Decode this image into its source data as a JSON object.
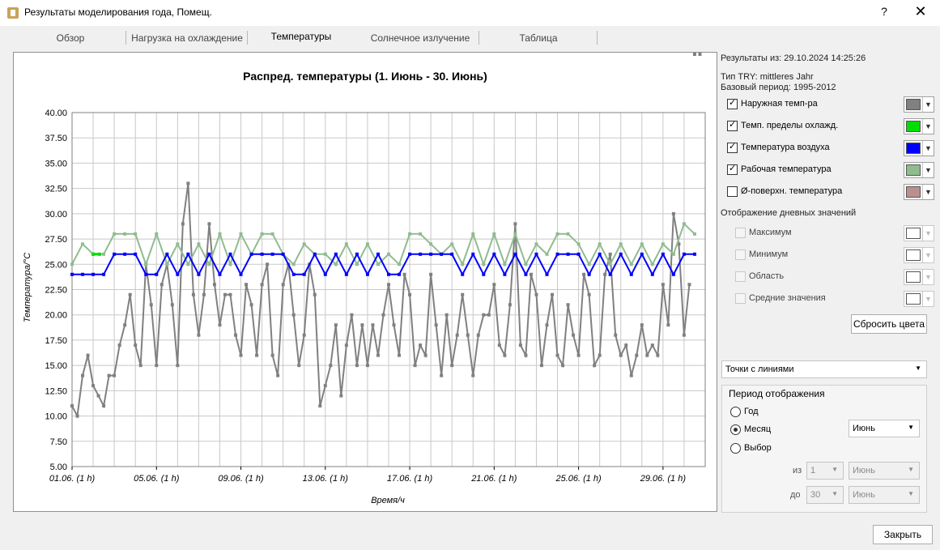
{
  "window": {
    "title": "Результаты моделирования года, Помещ.",
    "help": "?",
    "close": "✕"
  },
  "tabs": [
    "Обзор",
    "Нагрузка на охлаждение",
    "Температуры",
    "Солнечное излучение",
    "Таблица"
  ],
  "active_tab": "Температуры",
  "info": {
    "results_from": "Результаты из: 29.10.2024 14:25:26",
    "try_type": "Тип TRY: mittleres Jahr",
    "base_period": "Базовый период: 1995-2012"
  },
  "series_toggles": [
    {
      "label": "Наружная темп-ра",
      "checked": true,
      "color": "#808080"
    },
    {
      "label": "Темп. пределы охлажд.",
      "checked": true,
      "color": "#00dd00"
    },
    {
      "label": "Температура воздуха",
      "checked": true,
      "color": "#0000ff"
    },
    {
      "label": "Рабочая температура",
      "checked": true,
      "color": "#8fbc8f"
    },
    {
      "label": "Ø-поверхн. температура",
      "checked": false,
      "color": "#bc8f8f"
    }
  ],
  "daily_heading": "Отображение дневных значений",
  "daily_toggles": [
    {
      "label": "Максимум",
      "checked": false
    },
    {
      "label": "Минимум",
      "checked": false
    },
    {
      "label": "Область",
      "checked": false
    },
    {
      "label": "Средние значения",
      "checked": false
    }
  ],
  "reset_colors": "Сбросить цвета",
  "plot_style": "Точки с линиями",
  "period": {
    "title": "Период отображения",
    "options": [
      "Год",
      "Месяц",
      "Выбор"
    ],
    "selected": "Месяц",
    "month": "Июнь",
    "from_label": "из",
    "to_label": "до",
    "from_day": "1",
    "from_month": "Июнь",
    "to_day": "30",
    "to_month": "Июнь"
  },
  "close_button": "Закрыть",
  "chart_data": {
    "type": "line",
    "title": "Распред. температуры (1. Июнь - 30. Июнь)",
    "xlabel": "Время/ч",
    "ylabel": "Температура/°C",
    "ylim": [
      5,
      40
    ],
    "yticks": [
      "5.00",
      "7.50",
      "10.00",
      "12.50",
      "15.00",
      "17.50",
      "20.00",
      "22.50",
      "25.00",
      "27.50",
      "30.00",
      "32.50",
      "35.00",
      "37.50",
      "40.00"
    ],
    "xlim_days": [
      1,
      31
    ],
    "xtick_labels": [
      "01.06. (1 h)",
      "05.06. (1 h)",
      "09.06. (1 h)",
      "13.06. (1 h)",
      "17.06. (1 h)",
      "21.06. (1 h)",
      "25.06. (1 h)",
      "29.06. (1 h)"
    ],
    "xtick_days": [
      1,
      5,
      9,
      13,
      17,
      21,
      25,
      29
    ],
    "grid": true,
    "series": [
      {
        "name": "Наружная темп-ра",
        "color": "#808080",
        "days": [
          1,
          1.25,
          1.5,
          1.75,
          2,
          2.25,
          2.5,
          2.75,
          3,
          3.25,
          3.5,
          3.75,
          4,
          4.25,
          4.5,
          4.75,
          5,
          5.25,
          5.5,
          5.75,
          6,
          6.25,
          6.5,
          6.75,
          7,
          7.25,
          7.5,
          7.75,
          8,
          8.25,
          8.5,
          8.75,
          9,
          9.25,
          9.5,
          9.75,
          10,
          10.25,
          10.5,
          10.75,
          11,
          11.25,
          11.5,
          11.75,
          12,
          12.25,
          12.5,
          12.75,
          13,
          13.25,
          13.5,
          13.75,
          14,
          14.25,
          14.5,
          14.75,
          15,
          15.25,
          15.5,
          15.75,
          16,
          16.25,
          16.5,
          16.75,
          17,
          17.25,
          17.5,
          17.75,
          18,
          18.25,
          18.5,
          18.75,
          19,
          19.25,
          19.5,
          19.75,
          20,
          20.25,
          20.5,
          20.75,
          21,
          21.25,
          21.5,
          21.75,
          22,
          22.25,
          22.5,
          22.75,
          23,
          23.25,
          23.5,
          23.75,
          24,
          24.25,
          24.5,
          24.75,
          25,
          25.25,
          25.5,
          25.75,
          26,
          26.25,
          26.5,
          26.75,
          27,
          27.25,
          27.5,
          27.75,
          28,
          28.25,
          28.5,
          28.75,
          29,
          29.25,
          29.5,
          29.75,
          30,
          30.25,
          30.5,
          30.75
        ],
        "values": [
          11,
          10,
          14,
          16,
          13,
          12,
          11,
          14,
          14,
          17,
          19,
          22,
          17,
          15,
          25,
          21,
          15,
          23,
          25,
          21,
          15,
          29,
          33,
          22,
          18,
          22,
          29,
          23,
          19,
          22,
          22,
          18,
          16,
          23,
          21,
          16,
          23,
          25,
          16,
          14,
          23,
          25,
          20,
          15,
          18,
          25,
          22,
          11,
          13,
          15,
          19,
          12,
          17,
          20,
          15,
          19,
          15,
          19,
          16,
          20,
          23,
          19,
          16,
          24,
          22,
          15,
          17,
          16,
          24,
          19,
          14,
          20,
          15,
          18,
          22,
          18,
          14,
          18,
          20,
          20,
          23,
          17,
          16,
          21,
          29,
          17,
          16,
          24,
          22,
          15,
          19,
          22,
          16,
          15,
          21,
          18,
          16,
          24,
          22,
          15,
          16,
          24,
          26,
          18,
          16,
          17,
          14,
          16,
          19,
          16,
          17,
          16,
          23,
          19,
          30,
          27,
          18,
          23
        ]
      },
      {
        "name": "Темп. пределы охлажд.",
        "color": "#00dd00",
        "days": [
          2,
          2.3
        ],
        "values": [
          26,
          26
        ]
      },
      {
        "name": "Температура воздуха",
        "color": "#0000ff",
        "days": [
          1,
          1.5,
          2,
          2.5,
          3,
          3.5,
          4,
          4.5,
          5,
          5.5,
          6,
          6.5,
          7,
          7.5,
          8,
          8.5,
          9,
          9.5,
          10,
          10.5,
          11,
          11.5,
          12,
          12.5,
          13,
          13.5,
          14,
          14.5,
          15,
          15.5,
          16,
          16.5,
          17,
          17.5,
          18,
          18.5,
          19,
          19.5,
          20,
          20.5,
          21,
          21.5,
          22,
          22.5,
          23,
          23.5,
          24,
          24.5,
          25,
          25.5,
          26,
          26.5,
          27,
          27.5,
          28,
          28.5,
          29,
          29.5,
          30,
          30.5
        ],
        "values": [
          24,
          24,
          24,
          24,
          26,
          26,
          26,
          24,
          24,
          26,
          24,
          26,
          24,
          26,
          24,
          26,
          24,
          26,
          26,
          26,
          26,
          24,
          24,
          26,
          24,
          26,
          24,
          26,
          24,
          26,
          24,
          24,
          26,
          26,
          26,
          26,
          26,
          24,
          26,
          24,
          26,
          24,
          26,
          24,
          26,
          24,
          26,
          26,
          26,
          24,
          26,
          24,
          26,
          24,
          26,
          24,
          26,
          24,
          26,
          26
        ]
      },
      {
        "name": "Рабочая температура",
        "color": "#8fbc8f",
        "days": [
          1,
          1.5,
          2,
          2.5,
          3,
          3.5,
          4,
          4.5,
          5,
          5.5,
          6,
          6.5,
          7,
          7.5,
          8,
          8.5,
          9,
          9.5,
          10,
          10.5,
          11,
          11.5,
          12,
          12.5,
          13,
          13.5,
          14,
          14.5,
          15,
          15.5,
          16,
          16.5,
          17,
          17.5,
          18,
          18.5,
          19,
          19.5,
          20,
          20.5,
          21,
          21.5,
          22,
          22.5,
          23,
          23.5,
          24,
          24.5,
          25,
          25.5,
          26,
          26.5,
          27,
          27.5,
          28,
          28.5,
          29,
          29.5,
          30,
          30.5
        ],
        "values": [
          25,
          27,
          26,
          26,
          28,
          28,
          28,
          25,
          28,
          25,
          27,
          25,
          27,
          25,
          28,
          25,
          28,
          26,
          28,
          28,
          26,
          25,
          27,
          26,
          26,
          25,
          27,
          25,
          27,
          25,
          26,
          25,
          28,
          28,
          27,
          26,
          27,
          25,
          28,
          25,
          28,
          25,
          28,
          25,
          27,
          26,
          28,
          28,
          27,
          25,
          27,
          25,
          27,
          25,
          27,
          25,
          27,
          26,
          29,
          28
        ]
      }
    ]
  }
}
